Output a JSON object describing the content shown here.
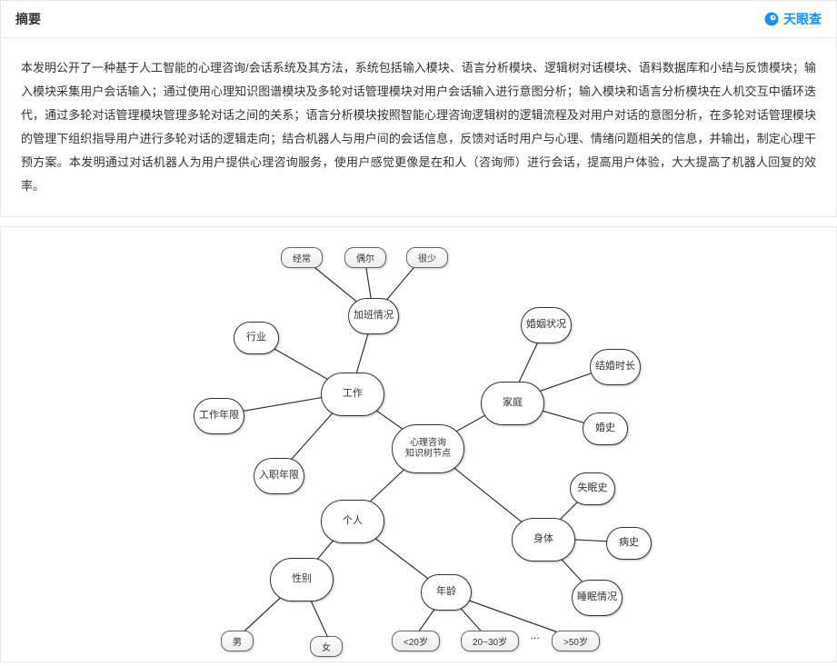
{
  "header": {
    "title": "摘要",
    "brand": "天眼查"
  },
  "abstract": "本发明公开了一种基于人工智能的心理咨询/会话系统及其方法，系统包括输入模块、语言分析模块、逻辑树对话模块、语料数据库和小结与反馈模块；输入模块采集用户会话输入；通过使用心理知识图谱模块及多轮对话管理模块对用户会话输入进行意图分析；输入模块和语言分析模块在人机交互中循环迭代，通过多轮对话管理模块管理多轮对话之间的关系；语言分析模块按照智能心理咨询逻辑树的逻辑流程及对用户对话的意图分析，在多轮对话管理模块的管理下组织指导用户进行多轮对话的逻辑走向；结合机器人与用户间的会话信息，反馈对话时用户与心理、情绪问题相关的信息，并输出，制定心理干预方案。本发明通过对话机器人为用户提供心理咨询服务，使用户感觉更像是在和人（咨询师）进行会话，提高用户体验，大大提高了机器人回复的效率。",
  "diagram": {
    "center": "心理咨询\n知识树节点",
    "nodes": {
      "work": "工作",
      "family": "家庭",
      "personal": "个人",
      "body": "身体",
      "industry": "行业",
      "work_years": "工作年限",
      "entry_years": "入职年限",
      "overtime": "加班情况",
      "marriage": "婚姻状况",
      "marriage_len": "结婚时长",
      "marriage_hist": "婚史",
      "gender": "性别",
      "age": "年龄",
      "insomnia": "失眠史",
      "illness": "病史",
      "sleep": "睡眠情况"
    },
    "leaves": {
      "often": "经常",
      "sometimes": "偶尔",
      "rarely": "很少",
      "male": "男",
      "female": "女",
      "age1": "<20岁",
      "age2": "20~30岁",
      "age3": ">50岁",
      "dots": "…"
    }
  }
}
